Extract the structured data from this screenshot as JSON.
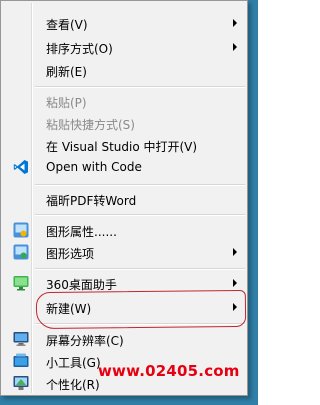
{
  "menu": {
    "items": [
      {
        "label": "查看(V)",
        "submenu": true
      },
      {
        "label": "排序方式(O)",
        "submenu": true
      },
      {
        "label": "刷新(E)"
      },
      {
        "label": "粘贴(P)",
        "disabled": true
      },
      {
        "label": "粘贴快捷方式(S)",
        "disabled": true
      },
      {
        "label": "在 Visual Studio 中打开(V)"
      },
      {
        "label": "Open with Code",
        "icon": "vscode-icon"
      },
      {
        "label": "福昕PDF转Word"
      },
      {
        "label": "图形属性......",
        "icon": "graphics-properties-icon"
      },
      {
        "label": "图形选项",
        "icon": "graphics-options-icon",
        "submenu": true
      },
      {
        "label": "360桌面助手",
        "icon": "360-desktop-assistant-icon",
        "submenu": true
      },
      {
        "label": "新建(W)",
        "submenu": true
      },
      {
        "label": "屏幕分辨率(C)",
        "icon": "screen-resolution-icon"
      },
      {
        "label": "小工具(G)",
        "icon": "gadgets-icon"
      },
      {
        "label": "个性化(R)",
        "icon": "personalize-icon"
      }
    ]
  },
  "watermark": {
    "text": "www.02405.com",
    "color": "#e60012"
  },
  "colors": {
    "menu_bg": "#f1f1f1",
    "highlight_box": "#c2272d",
    "vscode_blue": "#0078d4"
  }
}
